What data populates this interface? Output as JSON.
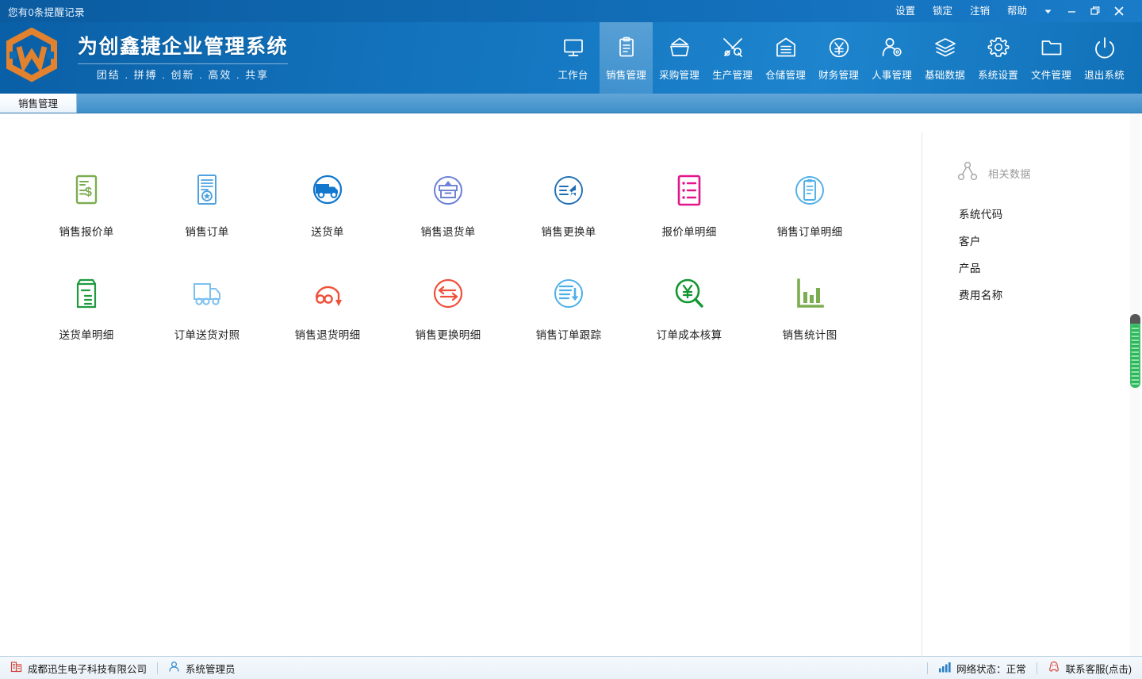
{
  "titlebar": {
    "notice": "您有0条提醒记录",
    "menus": [
      {
        "label": "设置",
        "name": "titlebar-settings"
      },
      {
        "label": "锁定",
        "name": "titlebar-lock"
      },
      {
        "label": "注销",
        "name": "titlebar-logout"
      },
      {
        "label": "帮助",
        "name": "titlebar-help"
      }
    ],
    "controls": {
      "dropdown": "dropdown-arrow-icon",
      "minimize": "minimize-icon",
      "maximize": "maximize-restore-icon",
      "close": "close-icon"
    }
  },
  "header": {
    "logo_alt": "hexagon-w-logo",
    "title": "为创鑫捷企业管理系统",
    "slogan": "团结 . 拼搏 . 创新 . 高效 . 共享",
    "nav": [
      {
        "label": "工作台",
        "icon": "monitor-icon",
        "active": false
      },
      {
        "label": "销售管理",
        "icon": "clipboard-icon",
        "active": true
      },
      {
        "label": "采购管理",
        "icon": "basket-icon",
        "active": false
      },
      {
        "label": "生产管理",
        "icon": "tools-icon",
        "active": false
      },
      {
        "label": "仓储管理",
        "icon": "warehouse-icon",
        "active": false
      },
      {
        "label": "财务管理",
        "icon": "yuan-circle-icon",
        "active": false
      },
      {
        "label": "人事管理",
        "icon": "user-gear-icon",
        "active": false
      },
      {
        "label": "基础数据",
        "icon": "layers-icon",
        "active": false
      },
      {
        "label": "系统设置",
        "icon": "gear-icon",
        "active": false
      },
      {
        "label": "文件管理",
        "icon": "folder-icon",
        "active": false
      },
      {
        "label": "退出系统",
        "icon": "power-icon",
        "active": false
      }
    ]
  },
  "tabs": [
    {
      "label": "销售管理",
      "active": true
    }
  ],
  "modules": [
    {
      "label": "销售报价单",
      "icon": "quote-document-icon",
      "color": "#7cad52"
    },
    {
      "label": "销售订单",
      "icon": "order-document-icon",
      "color": "#4ea3e0"
    },
    {
      "label": "送货单",
      "icon": "delivery-truck-icon",
      "color": "#1278cd"
    },
    {
      "label": "销售退货单",
      "icon": "return-box-icon",
      "color": "#6b7fd7"
    },
    {
      "label": "销售更换单",
      "icon": "exchange-arrow-icon",
      "color": "#1f6fb5"
    },
    {
      "label": "报价单明细",
      "icon": "quote-detail-list-icon",
      "color": "#e3158a"
    },
    {
      "label": "销售订单明细",
      "icon": "order-detail-clipboard-icon",
      "color": "#4eb0e8"
    },
    {
      "label": "送货单明细",
      "icon": "delivery-detail-icon",
      "color": "#1f9b3f"
    },
    {
      "label": "订单送货对照",
      "icon": "order-delivery-compare-icon",
      "color": "#7cc0ef"
    },
    {
      "label": "销售退货明细",
      "icon": "return-detail-icon",
      "color": "#f0503a"
    },
    {
      "label": "销售更换明细",
      "icon": "exchange-detail-icon",
      "color": "#f0503a"
    },
    {
      "label": "销售订单跟踪",
      "icon": "order-tracking-icon",
      "color": "#4eb0e8"
    },
    {
      "label": "订单成本核算",
      "icon": "cost-accounting-icon",
      "color": "#12962f"
    },
    {
      "label": "销售统计图",
      "icon": "bar-chart-icon",
      "color": "#7cad52"
    }
  ],
  "sidebar": {
    "header": "相关数据",
    "header_icon": "node-network-icon",
    "links": [
      {
        "label": "系统代码"
      },
      {
        "label": "客户"
      },
      {
        "label": "产品"
      },
      {
        "label": "费用名称"
      }
    ]
  },
  "statusbar": {
    "company": "成都迅生电子科技有限公司",
    "company_icon": "building-icon",
    "user": "系统管理员",
    "user_icon": "person-icon",
    "network": "网络状态：正常",
    "network_icon": "signal-bars-icon",
    "support": "联系客服(点击)",
    "support_icon": "qq-penguin-icon"
  },
  "colors": {
    "header_blue": "#1678c2",
    "titlebar_blue": "#0b5ba0",
    "logo_orange": "#e2822e",
    "scrollbar_green": "#3fbf6a"
  }
}
